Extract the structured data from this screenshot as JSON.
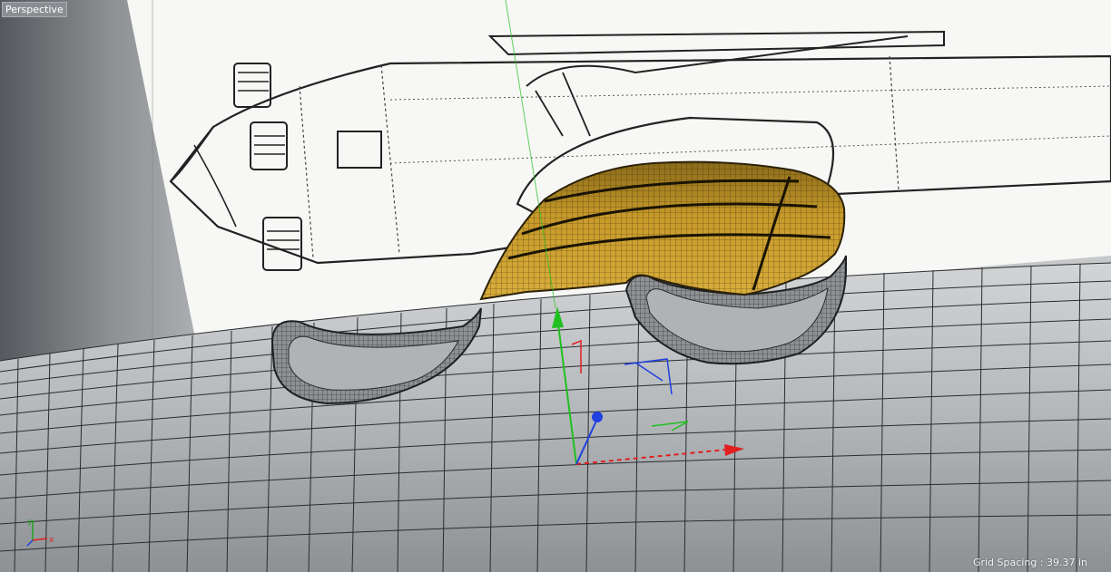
{
  "viewport": {
    "view_label": "Perspective",
    "grid_spacing_label": "Grid Spacing : 39.37 in"
  },
  "colors": {
    "background": "#c6c8ca",
    "fuselage_surface": "#b5b8bb",
    "wireframe": "#2a2c2e",
    "selected_patch": "#c79a2a",
    "blueprint_paper": "#f7f7f5",
    "axis_x": "#e02020",
    "axis_y": "#20c020",
    "axis_z": "#2040e0"
  },
  "objects": {
    "fuselage": "fuselage-mesh",
    "patch": "selected-patch-mesh",
    "ring_left": "tube-ring",
    "ring_right": "tube-ring",
    "reference_image": "biplane-blueprint"
  },
  "mini_axis": {
    "x_label": "x",
    "y_label": "y"
  }
}
